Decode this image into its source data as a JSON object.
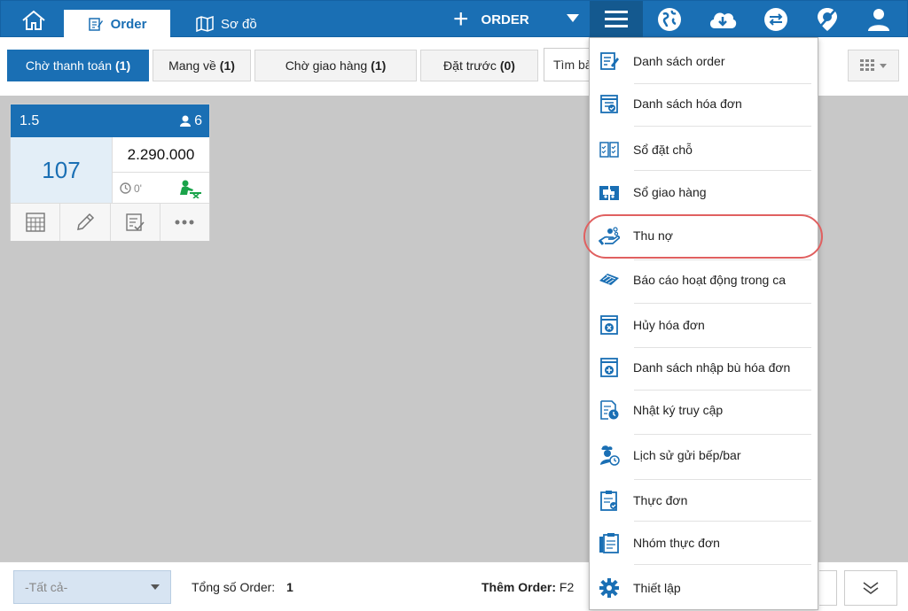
{
  "topbar": {
    "tabs": [
      {
        "label": "Order",
        "icon": "edit-note-icon"
      },
      {
        "label": "Sơ đồ",
        "icon": "map-icon"
      }
    ],
    "order_button_label": "ORDER",
    "icons": [
      "home-icon",
      "globe-icon",
      "cloud-download-icon",
      "sync-icon",
      "pin-off-icon",
      "user-icon",
      "menu-icon"
    ],
    "accent_color": "#1a6fb4"
  },
  "filters": {
    "tabs": [
      {
        "label": "Chờ thanh toán",
        "count": "(1)"
      },
      {
        "label": "Mang về",
        "count": "(1)"
      },
      {
        "label": "Chờ giao hàng",
        "count": "(1)"
      },
      {
        "label": "Đặt trước",
        "count": "(0)"
      }
    ],
    "search_text": "Tìm bàn"
  },
  "card": {
    "table": "1.5",
    "guests": "6",
    "order_no": "107",
    "amount": "2.290.000",
    "elapsed": "0'"
  },
  "bottom": {
    "all_select": "-Tất cả-",
    "total_label": "Tổng số Order:",
    "total_value": "1",
    "add_order_label": "Thêm Order:",
    "add_order_key": "F2"
  },
  "menu": {
    "items": [
      {
        "label": "Danh sách order",
        "icon": "order-list-icon"
      },
      {
        "label": "Danh sách hóa đơn",
        "icon": "invoice-list-icon"
      },
      {
        "label": "Sổ đặt chỗ",
        "icon": "reservation-book-icon"
      },
      {
        "label": "Sổ giao hàng",
        "icon": "delivery-book-icon"
      },
      {
        "label": "Thu nợ",
        "icon": "debt-collect-icon"
      },
      {
        "label": "Báo cáo hoạt động trong ca",
        "icon": "shift-report-icon"
      },
      {
        "label": "Hủy hóa đơn",
        "icon": "cancel-invoice-icon"
      },
      {
        "label": "Danh sách nhập bù hóa đơn",
        "icon": "add-invoice-icon"
      },
      {
        "label": "Nhật ký truy cập",
        "icon": "access-log-icon"
      },
      {
        "label": "Lịch sử gửi bếp/bar",
        "icon": "chef-history-icon"
      },
      {
        "label": "Thực đơn",
        "icon": "menu-clipboard-icon"
      },
      {
        "label": "Nhóm thực đơn",
        "icon": "menu-group-icon"
      },
      {
        "label": "Thiết lập",
        "icon": "settings-gear-icon"
      }
    ],
    "highlighted": "Thu nợ"
  }
}
